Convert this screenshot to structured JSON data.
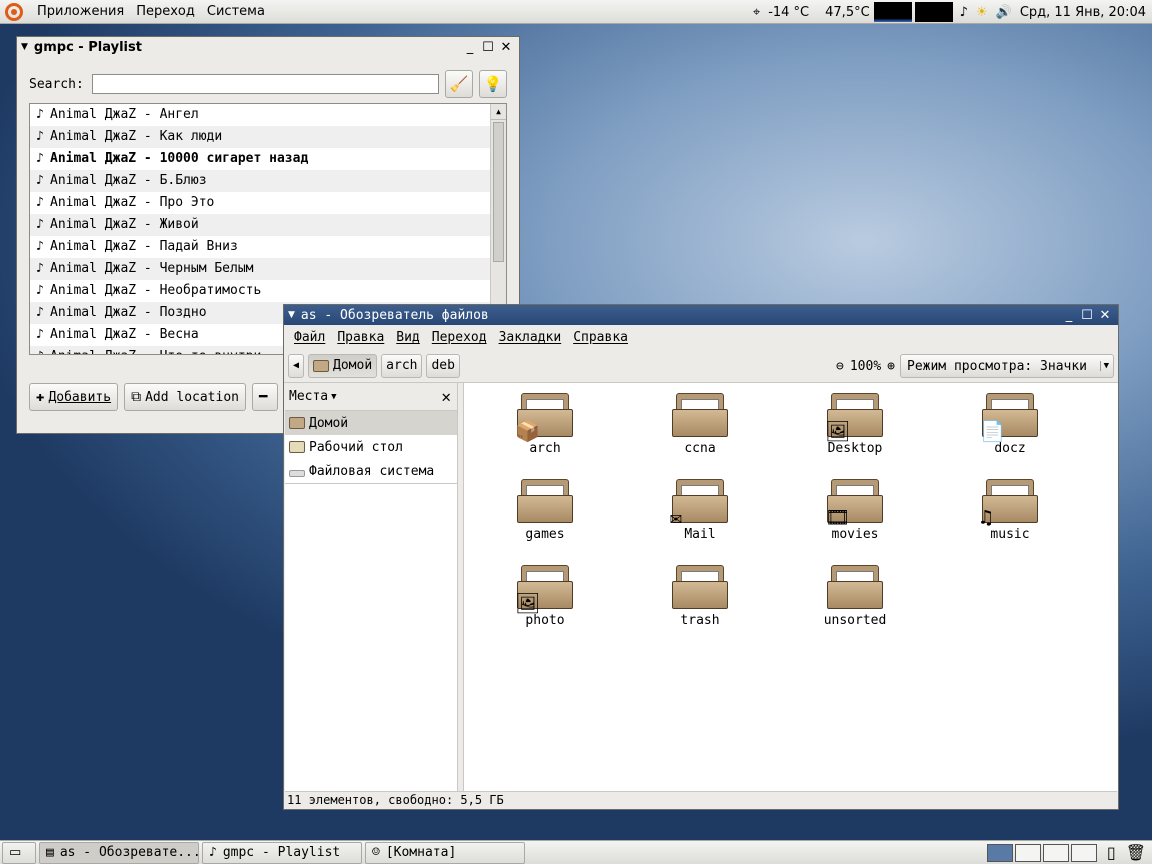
{
  "top_panel": {
    "menus": [
      "Приложения",
      "Переход",
      "Система"
    ],
    "temp": "-14 °C",
    "cpu_temp": "47,5°C",
    "clock": "Срд, 11 Янв, 20:04"
  },
  "gmpc": {
    "title": "gmpc - Playlist",
    "search_label": "Search:",
    "search_value": "",
    "playlist": [
      "Animal ДжаZ - Ангел",
      "Animal ДжаZ - Как люди",
      "Animal ДжаZ - 10000 сигарет назад",
      "Animal ДжаZ - Б.Блюз",
      "Animal ДжаZ - Про Это",
      "Animal ДжаZ - Живой",
      "Animal ДжаZ - Падай Вниз",
      "Animal ДжаZ - Черным Белым",
      "Animal ДжаZ - Необратимость",
      "Animal ДжаZ - Поздно",
      "Animal ДжаZ - Весна",
      "Animal ДжаZ - Что-то внутри"
    ],
    "bold_index": 2,
    "buttons": {
      "add": "Добавить",
      "add_location": "Add location"
    }
  },
  "nautilus": {
    "title": "as - Обозреватель файлов",
    "menus": [
      "Файл",
      "Правка",
      "Вид",
      "Переход",
      "Закладки",
      "Справка"
    ],
    "path": [
      "Домой",
      "arch",
      "deb"
    ],
    "zoom": "100%",
    "view_mode": "Режим просмотра: Значки",
    "sidebar_title": "Места",
    "places": [
      "Домой",
      "Рабочий стол",
      "Файловая система"
    ],
    "files": [
      "arch",
      "ccna",
      "Desktop",
      "docz",
      "games",
      "Mail",
      "movies",
      "music",
      "photo",
      "trash",
      "unsorted"
    ],
    "status": "11 элементов, свободно: 5,5 ГБ"
  },
  "taskbar": {
    "tasks": [
      "as - Обозревате...",
      "gmpc - Playlist",
      "[Комната]"
    ]
  },
  "colors": {
    "title_active": "#2f5283",
    "folder": "#b69a76",
    "desktop": "#3e6391"
  }
}
